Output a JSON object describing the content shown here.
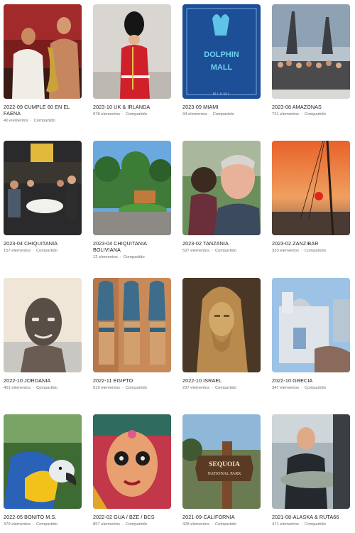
{
  "albums": [
    {
      "title": "2022-09 CUMPLE 60 EN EL FAENA",
      "count": "40 elementos",
      "shared": "Compartido",
      "icon": "photo-saxophone"
    },
    {
      "title": "2023-10 UK & IRLANDA",
      "count": "978 elementos",
      "shared": "Compartido",
      "icon": "photo-royal-guard"
    },
    {
      "title": "2023-09 MIAMI",
      "count": "34 elementos",
      "shared": "Compartido",
      "icon": "photo-dolphin-mall"
    },
    {
      "title": "2023-08 AMAZONAS",
      "count": "731 elementos",
      "shared": "Compartido",
      "icon": "photo-group-monument"
    },
    {
      "title": "2023-04 CHIQUITANIA",
      "count": "157 elementos",
      "shared": "Compartido",
      "icon": "photo-restaurant-group"
    },
    {
      "title": "2023-04 CHIQUITANIA BOLIVIANA",
      "count": "12 elementos",
      "shared": "Compartido",
      "icon": "photo-garden"
    },
    {
      "title": "2023-02 TANZANIA",
      "count": "537 elementos",
      "shared": "Compartido",
      "icon": "photo-selfie-child"
    },
    {
      "title": "2023-02 ZANZIBAR",
      "count": "333 elementos",
      "shared": "Compartido",
      "icon": "photo-sunset"
    },
    {
      "title": "2022-10 JORDANIA",
      "count": "401 elementos",
      "shared": "Compartido",
      "icon": "photo-mud-mask"
    },
    {
      "title": "2022-11 EGIPTO",
      "count": "519 elementos",
      "shared": "Compartido",
      "icon": "photo-egyptian-carvings"
    },
    {
      "title": "2022-10 ISRAEL",
      "count": "237 elementos",
      "shared": "Compartido",
      "icon": "photo-wooden-jesus"
    },
    {
      "title": "2022-10 GRECIA",
      "count": "347 elementos",
      "shared": "Compartido",
      "icon": "photo-greek-church"
    },
    {
      "title": "2022-05 BONITO M.S.",
      "count": "379 elementos",
      "shared": "Compartido",
      "icon": "photo-macaw"
    },
    {
      "title": "2022-02 GUA / BZE / BCS",
      "count": "857 elementos",
      "shared": "Compartido",
      "icon": "photo-catrina-art"
    },
    {
      "title": "2021-09-CALIFORNIA",
      "count": "428 elementos",
      "shared": "Compartido",
      "icon": "photo-sequoia-sign"
    },
    {
      "title": "2021-08-ALASKA & RUTA66",
      "count": "471 elementos",
      "shared": "Compartido",
      "icon": "photo-fish-catch"
    }
  ],
  "thumb_text": {
    "dolphin_mall_line1": "DOLPHIN",
    "dolphin_mall_line2": "MALL",
    "dolphin_mall_line3": "MIAMI",
    "sequoia_line1": "SEQUOIA",
    "sequoia_line2": "NATIONAL PARK"
  },
  "separator": "·"
}
